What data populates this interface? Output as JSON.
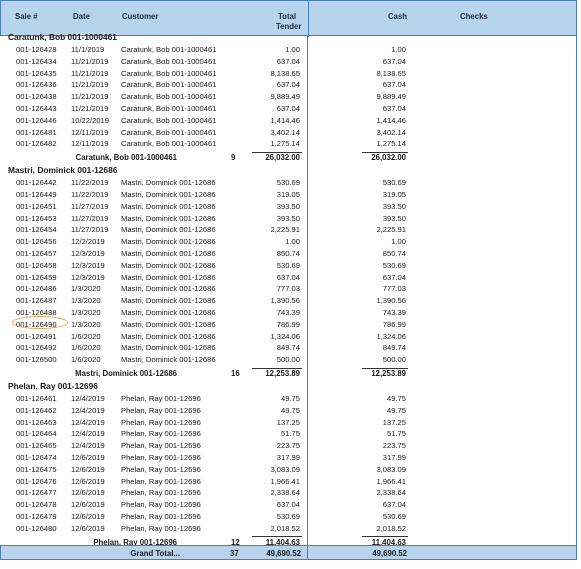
{
  "header": {
    "sale": "Sale #",
    "date": "Date",
    "customer": "Customer",
    "total_line1": "Total",
    "total_line2": "Tender",
    "cash": "Cash",
    "checks": "Checks"
  },
  "groups": [
    {
      "title": "Caratunk, Bob 001-1000461",
      "rows": [
        {
          "sale": "001-126428",
          "date": "11/1/2019",
          "customer": "Caratunk, Bob 001-1000461",
          "total": "1.00",
          "cash": "1.00"
        },
        {
          "sale": "001-126434",
          "date": "11/21/2019",
          "customer": "Caratunk, Bob 001-1000461",
          "total": "637.04",
          "cash": "637.04"
        },
        {
          "sale": "001-126435",
          "date": "11/21/2019",
          "customer": "Caratunk, Bob 001-1000461",
          "total": "8,138.65",
          "cash": "8,138.65"
        },
        {
          "sale": "001-126436",
          "date": "11/21/2019",
          "customer": "Caratunk, Bob 001-1000461",
          "total": "637.04",
          "cash": "637.04"
        },
        {
          "sale": "001-126438",
          "date": "11/21/2019",
          "customer": "Caratunk, Bob 001-1000461",
          "total": "9,889.49",
          "cash": "9,889.49"
        },
        {
          "sale": "001-126443",
          "date": "11/21/2019",
          "customer": "Caratunk, Bob 001-1000461",
          "total": "637.04",
          "cash": "637.04"
        },
        {
          "sale": "001-126446",
          "date": "10/22/2019",
          "customer": "Caratunk, Bob 001-1000461",
          "total": "1,414.46",
          "cash": "1,414.46"
        },
        {
          "sale": "001-126481",
          "date": "12/11/2019",
          "customer": "Caratunk, Bob 001-1000461",
          "total": "3,402.14",
          "cash": "3,402.14"
        },
        {
          "sale": "001-126482",
          "date": "12/11/2019",
          "customer": "Caratunk, Bob 001-1000461",
          "total": "1,275.14",
          "cash": "1,275.14"
        }
      ],
      "subtotal": {
        "name": "Caratunk, Bob 001-1000461",
        "count": "9",
        "total": "26,032.00",
        "cash": "26,032.00"
      }
    },
    {
      "title": "Mastri, Dominick 001-12686",
      "rows": [
        {
          "sale": "001-126442",
          "date": "11/22/2019",
          "customer": "Mastri, Dominick 001-12686",
          "total": "530.69",
          "cash": "530.69"
        },
        {
          "sale": "001-126449",
          "date": "11/22/2019",
          "customer": "Mastri, Dominick 001-12686",
          "total": "319.05",
          "cash": "319.05"
        },
        {
          "sale": "001-126451",
          "date": "11/27/2019",
          "customer": "Mastri, Dominick 001-12686",
          "total": "393.50",
          "cash": "393.50"
        },
        {
          "sale": "001-126453",
          "date": "11/27/2019",
          "customer": "Mastri, Dominick 001-12686",
          "total": "393.50",
          "cash": "393.50"
        },
        {
          "sale": "001-126454",
          "date": "11/27/2019",
          "customer": "Mastri, Dominick 001-12686",
          "total": "2,225.91",
          "cash": "2,225.91"
        },
        {
          "sale": "001-126456",
          "date": "12/2/2019",
          "customer": "Mastri, Dominick 001-12686",
          "total": "1.00",
          "cash": "1.00"
        },
        {
          "sale": "001-126457",
          "date": "12/3/2019",
          "customer": "Mastri, Dominick 001-12686",
          "total": "850.74",
          "cash": "850.74"
        },
        {
          "sale": "001-126458",
          "date": "12/3/2019",
          "customer": "Mastri, Dominick 001-12686",
          "total": "530.69",
          "cash": "530.69"
        },
        {
          "sale": "001-126459",
          "date": "12/3/2019",
          "customer": "Mastri, Dominick 001-12686",
          "total": "637.04",
          "cash": "637.04"
        },
        {
          "sale": "001-126486",
          "date": "1/3/2020",
          "customer": "Mastri, Dominick 001-12686",
          "total": "777.03",
          "cash": "777.03"
        },
        {
          "sale": "001-126487",
          "date": "1/3/2020",
          "customer": "Mastri, Dominick 001-12686",
          "total": "1,390.56",
          "cash": "1,390.56"
        },
        {
          "sale": "001-126488",
          "date": "1/3/2020",
          "customer": "Mastri, Dominick 001-12686",
          "total": "743.39",
          "cash": "743.39"
        },
        {
          "sale": "001-126490",
          "date": "1/3/2020",
          "customer": "Mastri, Dominick 001-12686",
          "total": "786.99",
          "cash": "786.99"
        },
        {
          "sale": "001-126491",
          "date": "1/6/2020",
          "customer": "Mastri, Dominick 001-12686",
          "total": "1,324.06",
          "cash": "1,324.06"
        },
        {
          "sale": "001-126492",
          "date": "1/6/2020",
          "customer": "Mastri, Dominick 001-12686",
          "total": "849.74",
          "cash": "849.74"
        },
        {
          "sale": "001-126500",
          "date": "1/6/2020",
          "customer": "Mastri, Dominick 001-12686",
          "total": "500.00",
          "cash": "500.00"
        }
      ],
      "subtotal": {
        "name": "Mastri, Dominick 001-12686",
        "count": "16",
        "total": "12,253.89",
        "cash": "12,253.89"
      }
    },
    {
      "title": "Phelan, Ray 001-12696",
      "rows": [
        {
          "sale": "001-126461",
          "date": "12/4/2019",
          "customer": "Phelan, Ray 001-12696",
          "total": "49.75",
          "cash": "49.75"
        },
        {
          "sale": "001-126462",
          "date": "12/4/2019",
          "customer": "Phelan, Ray 001-12696",
          "total": "49.75",
          "cash": "49.75"
        },
        {
          "sale": "001-126463",
          "date": "12/4/2019",
          "customer": "Phelan, Ray 001-12696",
          "total": "137.25",
          "cash": "137.25"
        },
        {
          "sale": "001-126464",
          "date": "12/4/2019",
          "customer": "Phelan, Ray 001-12696",
          "total": "51.75",
          "cash": "51.75"
        },
        {
          "sale": "001-126465",
          "date": "12/4/2019",
          "customer": "Phelan, Ray 001-12696",
          "total": "223.75",
          "cash": "223.75"
        },
        {
          "sale": "001-126474",
          "date": "12/6/2019",
          "customer": "Phelan, Ray 001-12696",
          "total": "317.99",
          "cash": "317.99"
        },
        {
          "sale": "001-126475",
          "date": "12/6/2019",
          "customer": "Phelan, Ray 001-12696",
          "total": "3,083.09",
          "cash": "3,083.09"
        },
        {
          "sale": "001-126476",
          "date": "12/6/2019",
          "customer": "Phelan, Ray 001-12696",
          "total": "1,966.41",
          "cash": "1,966.41"
        },
        {
          "sale": "001-126477",
          "date": "12/6/2019",
          "customer": "Phelan, Ray 001-12696",
          "total": "2,338.64",
          "cash": "2,338.64"
        },
        {
          "sale": "001-126478",
          "date": "12/6/2019",
          "customer": "Phelan, Ray 001-12696",
          "total": "637.04",
          "cash": "637.04"
        },
        {
          "sale": "001-126479",
          "date": "12/6/2019",
          "customer": "Phelan, Ray 001-12696",
          "total": "530.69",
          "cash": "530.69"
        },
        {
          "sale": "001-126480",
          "date": "12/6/2019",
          "customer": "Phelan, Ray 001-12696",
          "total": "2,018.52",
          "cash": "2,018.52"
        }
      ],
      "subtotal": {
        "name": "Phelan, Ray 001-12696",
        "count": "12",
        "total": "11,404.63",
        "cash": "11,404.63"
      }
    }
  ],
  "grand_total": {
    "label": "Grand Total...",
    "count": "37",
    "total": "49,690.52",
    "cash": "49,690.52"
  },
  "colors": {
    "header_bg": "#b8d4ec",
    "border": "#4a7fb5",
    "annotation": "#e6a44a"
  }
}
